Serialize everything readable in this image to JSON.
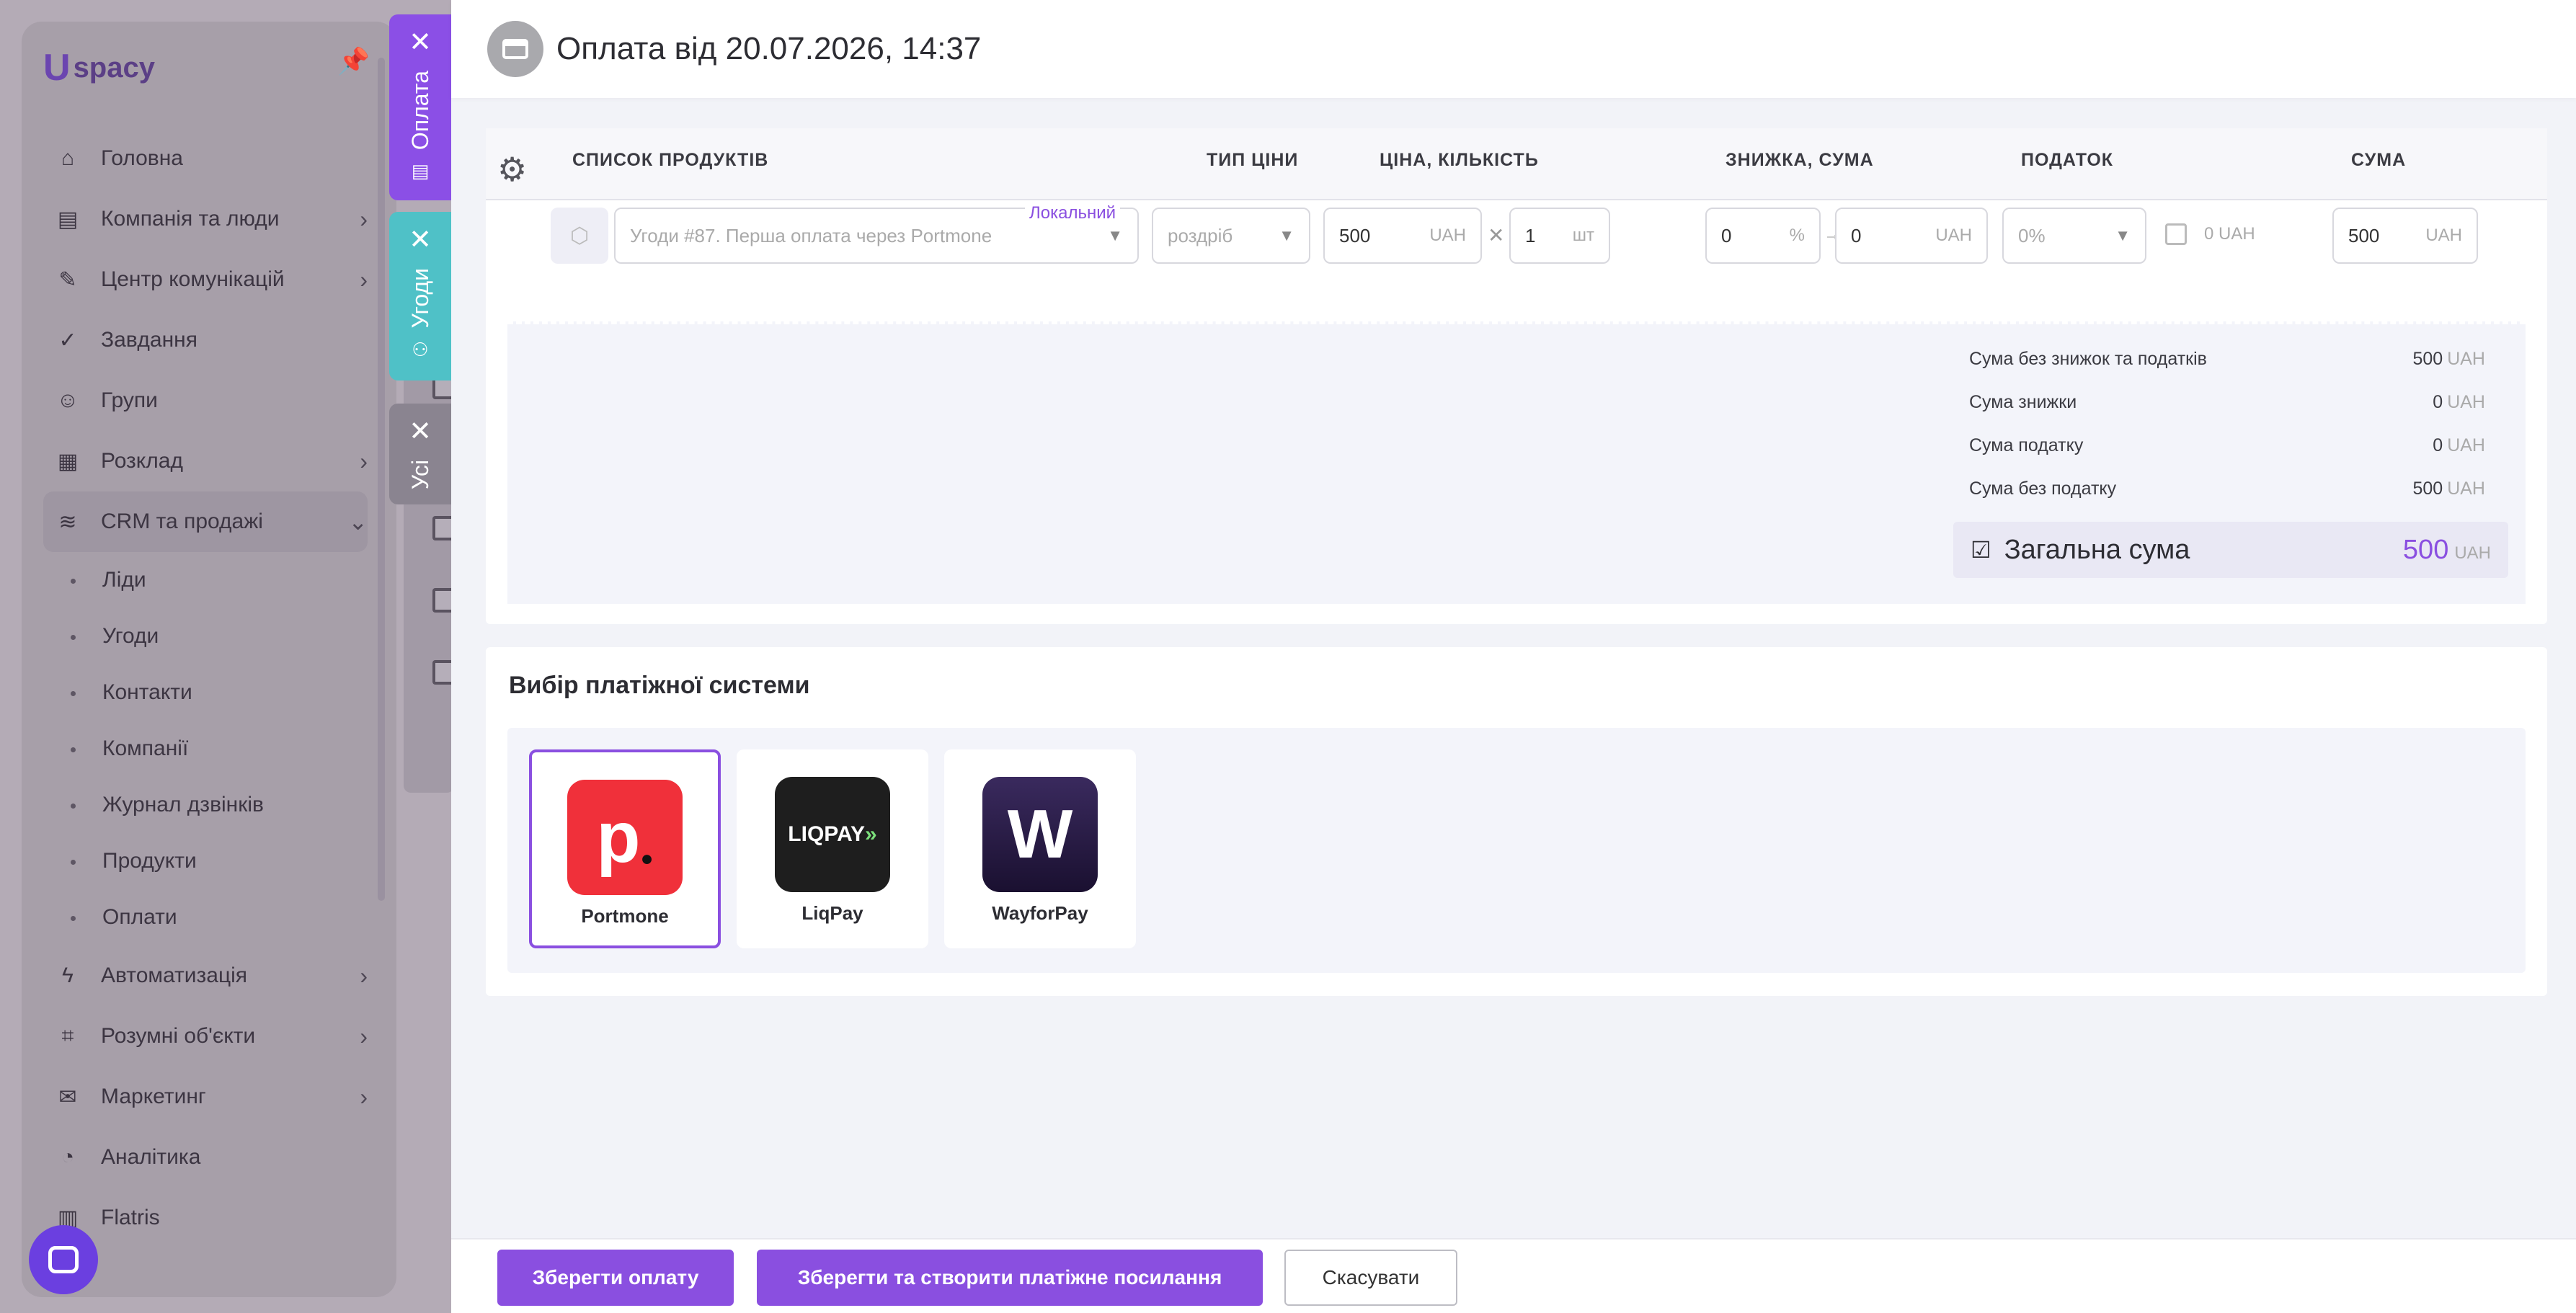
{
  "sidebar": {
    "logo": "spacy",
    "items": [
      {
        "label": "Головна",
        "icon": "home-icon",
        "has_submenu": false
      },
      {
        "label": "Компанія та люди",
        "icon": "company-icon",
        "has_submenu": true
      },
      {
        "label": "Центр комунікацій",
        "icon": "chat-icon",
        "has_submenu": true
      },
      {
        "label": "Завдання",
        "icon": "check-icon",
        "has_submenu": false
      },
      {
        "label": "Групи",
        "icon": "groups-icon",
        "has_submenu": false
      },
      {
        "label": "Розклад",
        "icon": "calendar-icon",
        "has_submenu": true
      },
      {
        "label": "CRM та продажі",
        "icon": "crm-icon",
        "has_submenu": true,
        "expanded": true
      }
    ],
    "subitems": [
      "Ліди",
      "Угоди",
      "Контакти",
      "Компанії",
      "Журнал дзвінків",
      "Продукти",
      "Оплати"
    ],
    "items_bottom": [
      {
        "label": "Автоматизація",
        "icon": "lightning-icon",
        "has_submenu": true
      },
      {
        "label": "Розумні об'єкти",
        "icon": "smart-object-icon",
        "has_submenu": true
      },
      {
        "label": "Маркетинг",
        "icon": "marketing-icon",
        "has_submenu": true
      },
      {
        "label": "Аналітика",
        "icon": "analytics-icon",
        "has_submenu": false
      },
      {
        "label": "Flatris",
        "icon": "flatris-icon",
        "has_submenu": false
      }
    ]
  },
  "side_tabs": [
    {
      "label": "Оплата",
      "color": "#8b4fe6"
    },
    {
      "label": "Угоди",
      "color": "#4fc1c7"
    },
    {
      "label": "Усі",
      "color": "#8a8490"
    }
  ],
  "header": {
    "title": "Оплата від 20.07.2026, 14:37"
  },
  "table": {
    "headers": [
      "СПИСОК ПРОДУКТІВ",
      "ТИП ЦІНИ",
      "ЦІНА, КІЛЬКІСТЬ",
      "ЗНИЖКА, СУМА",
      "ПОДАТОК",
      "СУМА"
    ],
    "row": {
      "product": "Угоди #87. Перша оплата через Portmone",
      "product_badge": "Локальний",
      "price_type": "роздріб",
      "price": "500",
      "price_unit": "UAH",
      "times": "✕",
      "qty": "1",
      "qty_unit": "шт",
      "discount": "0",
      "discount_unit": "%",
      "arrow": "→",
      "discount_sum": "0",
      "discount_sum_unit": "UAH",
      "tax": "0%",
      "tax_amount": "0",
      "tax_unit": "UAH",
      "sum": "500",
      "sum_unit": "UAH"
    }
  },
  "summary": {
    "lines": [
      {
        "label": "Сума без знижок та податків",
        "value": "500",
        "unit": "UAH"
      },
      {
        "label": "Сума знижки",
        "value": "0",
        "unit": "UAH"
      },
      {
        "label": "Сума податку",
        "value": "0",
        "unit": "UAH"
      },
      {
        "label": "Сума без податку",
        "value": "500",
        "unit": "UAH"
      }
    ],
    "total_label": "Загальна сума",
    "total_value": "500",
    "total_unit": "UAH"
  },
  "payment": {
    "title": "Вибір платіжної системи",
    "systems": [
      {
        "name": "Portmone",
        "selected": true,
        "color": "#f0303a"
      },
      {
        "name": "LiqPay",
        "selected": false,
        "color": "#1e1e1e",
        "logo_text": "LIQPAY"
      },
      {
        "name": "WayforPay",
        "selected": false,
        "color": "#2a1a4a",
        "logo_text": "W"
      }
    ]
  },
  "footer": {
    "save": "Зберегти оплату",
    "save_link": "Зберегти та створити платіжне посилання",
    "cancel": "Скасувати"
  }
}
